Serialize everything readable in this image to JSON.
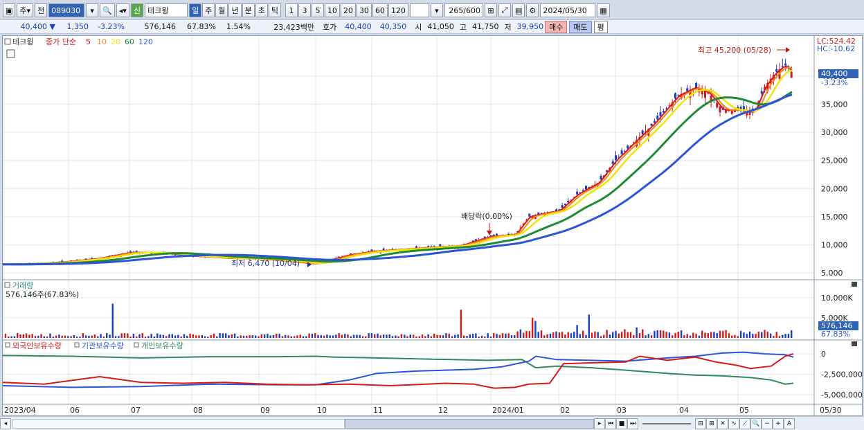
{
  "toolbar": {
    "market": "주",
    "prev_label": "전",
    "code": "089030",
    "credit_badge": "신",
    "stock_name": "테크윙",
    "periods": [
      "일",
      "주",
      "월",
      "년",
      "분",
      "초",
      "틱"
    ],
    "active_period": "일",
    "intervals": [
      "1",
      "3",
      "5",
      "10",
      "20",
      "30",
      "60",
      "120"
    ],
    "count": "265",
    "count_total": "/600",
    "date": "2024/05/30"
  },
  "quote": {
    "price": "40,400",
    "change": "1,350",
    "change_pct": "-3.23%",
    "volume": "576,146",
    "vol_ratio": "67.83%",
    "turnover_pct": "1.54%",
    "amount": "23,423백만",
    "bid_label": "호가",
    "bid1": "40,400",
    "bid2": "40,350",
    "open_label": "시",
    "open": "41,050",
    "high_label": "고",
    "high": "41,750",
    "low_label": "저",
    "low": "39,950",
    "buy_label": "매수",
    "sell_label": "매도",
    "eval_label": "평"
  },
  "price_panel": {
    "legend_name": "테크윙",
    "legend_ma": "종가 단순",
    "ma_periods": [
      "5",
      "10",
      "20",
      "60",
      "120"
    ],
    "ma_colors": [
      "#e0141c",
      "#f08a1a",
      "#f4e20a",
      "#1e8b34",
      "#2b55d6"
    ],
    "lc_text": "LC:524.42",
    "hc_text": "HC:-10.62",
    "high_annotation": "최고 45,200 (05/28)",
    "low_annotation": "최저 6,470 (10/04)",
    "dividend_annotation": "배당락(0.00%)",
    "price_tag": "40,400",
    "change_tag": "-3.23%",
    "y_ticks": [
      "40,000",
      "35,000",
      "30,000",
      "25,000",
      "20,000",
      "15,000",
      "10,000",
      "5,000"
    ]
  },
  "volume_panel": {
    "title": "거래량",
    "value_text": "576,146주(67.83%)",
    "y_ticks": [
      "10,000K",
      "5,000K"
    ],
    "tag_value": "576,146",
    "tag_pct": "67.83%"
  },
  "holdings_panel": {
    "legend": [
      "외국인보유수량",
      "기관보유수량",
      "개인보유수량"
    ],
    "legend_colors": [
      "#d41a1a",
      "#2b55d6",
      "#2e8b57"
    ],
    "y_ticks": [
      "0",
      "-2,500,000",
      "-5,000,000"
    ]
  },
  "x_axis": {
    "labels": [
      "2023/04",
      "06",
      "07",
      "08",
      "09",
      "10",
      "11",
      "12",
      "2024/01",
      "02",
      "03",
      "04",
      "05"
    ],
    "right_label": "05/30"
  },
  "chart_data": {
    "type": "candlestick",
    "title": "테크윙",
    "price_series_approx": [
      {
        "x": "2023/04",
        "close": 6500
      },
      {
        "x": "06",
        "close": 7000
      },
      {
        "x": "07",
        "close": 8600
      },
      {
        "x": "08",
        "close": 8000
      },
      {
        "x": "09",
        "close": 7500
      },
      {
        "x": "10",
        "close": 6600
      },
      {
        "x": "11",
        "close": 8800
      },
      {
        "x": "12",
        "close": 9600
      },
      {
        "x": "2024/01",
        "close": 11500
      },
      {
        "x": "02",
        "close": 16000
      },
      {
        "x": "03",
        "close": 25000
      },
      {
        "x": "04",
        "close": 36500
      },
      {
        "x": "05",
        "close": 34000
      },
      {
        "x": "05/30",
        "close": 40400
      }
    ],
    "high": 45200,
    "low": 6470,
    "ylim": [
      4000,
      45000
    ]
  }
}
